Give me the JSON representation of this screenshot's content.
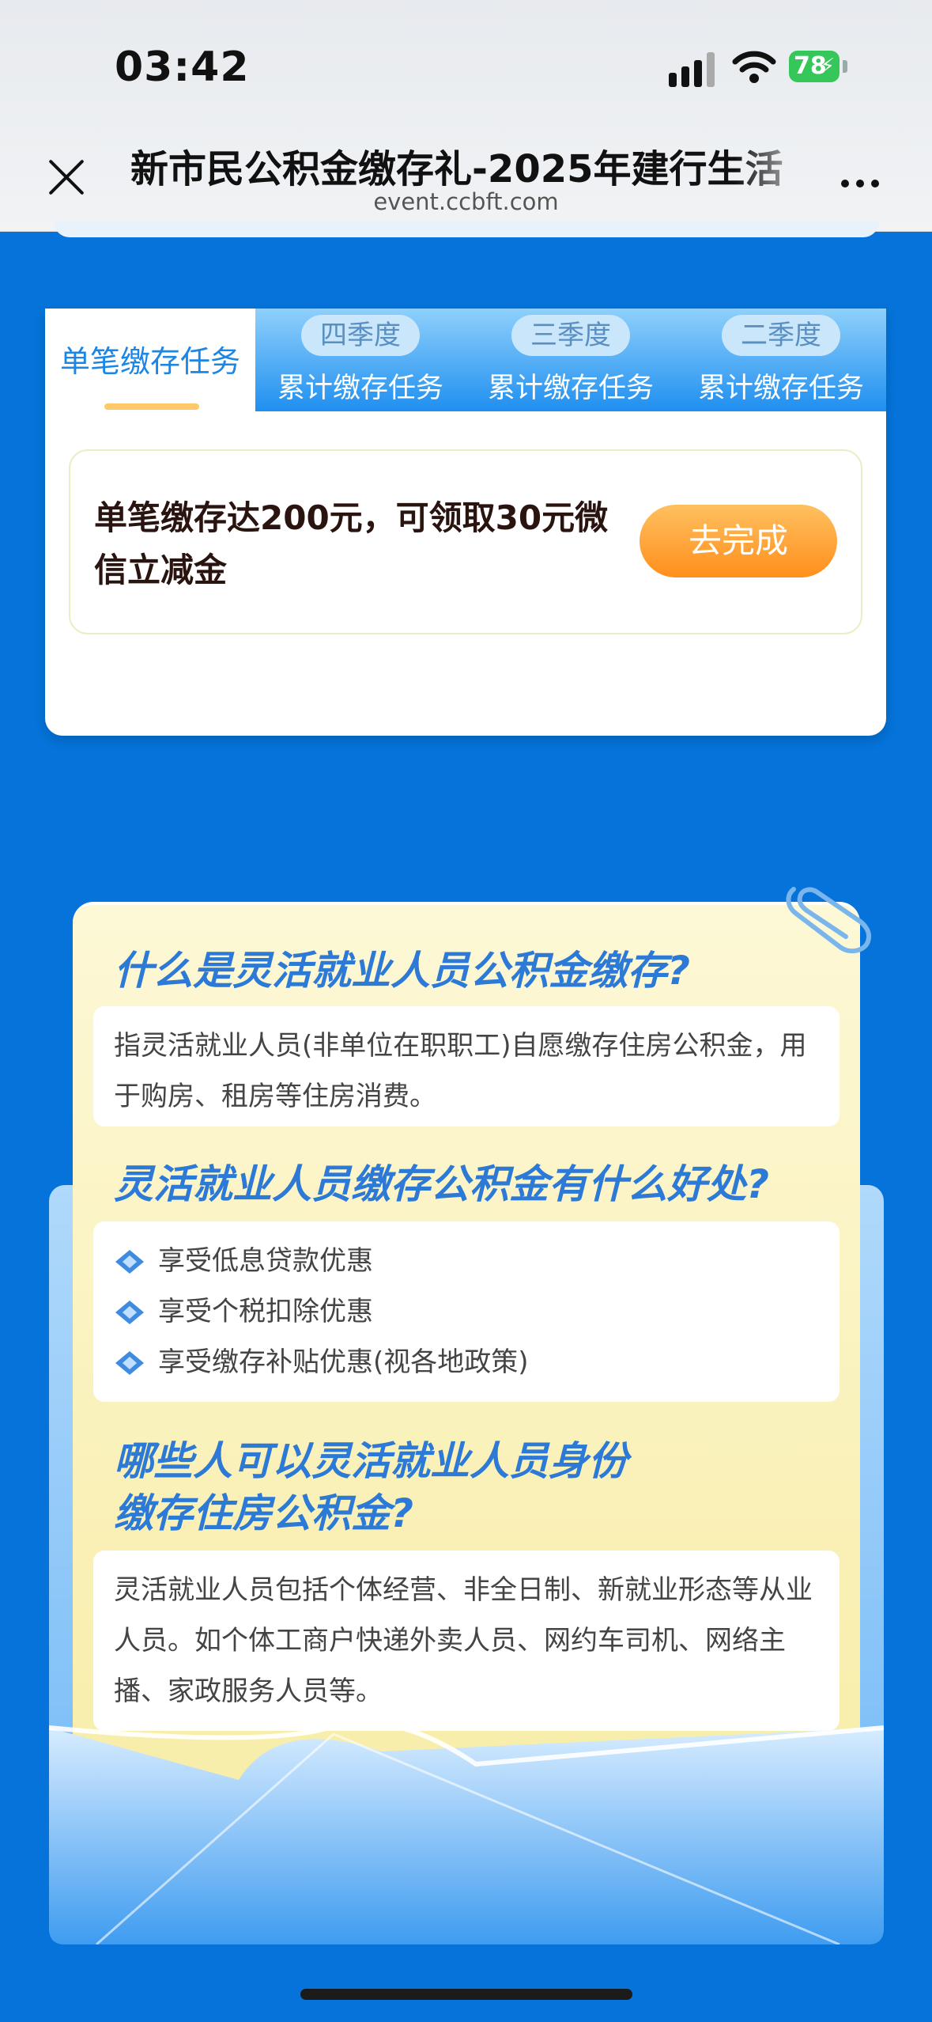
{
  "status_bar": {
    "time": "03:42",
    "battery": "78"
  },
  "nav": {
    "title": "新市民公积金缴存礼-2025年建行生活",
    "url": "event.ccbft.com"
  },
  "tabs": [
    {
      "label": "单笔缴存任务",
      "active": true
    },
    {
      "season": "四季度",
      "label": "累计缴存任务"
    },
    {
      "season": "三季度",
      "label": "累计缴存任务"
    },
    {
      "season": "二季度",
      "label": "累计缴存任务"
    }
  ],
  "task": {
    "description": "单笔缴存达200元，可领取30元微信立减金",
    "button_label": "去完成"
  },
  "faq": {
    "q1": "什么是灵活就业人员公积金缴存?",
    "a1": "指灵活就业人员(非单位在职职工)自愿缴存住房公积金，用于购房、租房等住房消费。",
    "q2": "灵活就业人员缴存公积金有什么好处?",
    "benefits": [
      "享受低息贷款优惠",
      "享受个税扣除优惠",
      "享受缴存补贴优惠(视各地政策)"
    ],
    "q3_line1": "哪些人可以灵活就业人员身份",
    "q3_line2": "缴存住房公积金?",
    "a3": "灵活就业人员包括个体经营、非全日制、新就业形态等从业人员。如个体工商户快递外卖人员、网约车司机、网络主播、家政服务人员等。"
  },
  "colors": {
    "page_bg": "#0573d9",
    "accent_blue": "#1a86e6",
    "button_orange": "#ff9a2a",
    "battery_green": "#35c759"
  },
  "icons": [
    "close-icon",
    "more-icon",
    "signal-icon",
    "wifi-icon",
    "battery-icon",
    "diamond-bullet-icon",
    "paperclip-icon"
  ]
}
